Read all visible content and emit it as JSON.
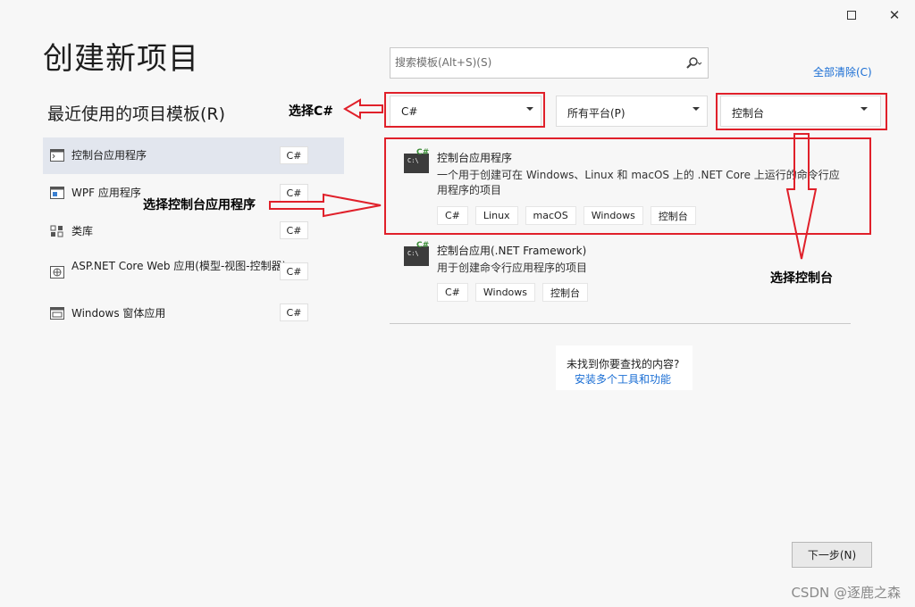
{
  "window": {
    "maximize_icon": "maximize-icon",
    "close_glyph": "✕"
  },
  "page_title": "创建新项目",
  "recent": {
    "heading": "最近使用的项目模板(R)",
    "items": [
      {
        "label": "控制台应用程序",
        "lang": "C#",
        "icon": "console-app-icon"
      },
      {
        "label": "WPF 应用程序",
        "lang": "C#",
        "icon": "wpf-app-icon"
      },
      {
        "label": "类库",
        "lang": "C#",
        "icon": "class-library-icon"
      },
      {
        "label": "ASP.NET Core Web 应用(模型-视图-控制器)",
        "lang": "C#",
        "icon": "web-app-icon"
      },
      {
        "label": "Windows 窗体应用",
        "lang": "C#",
        "icon": "winforms-app-icon"
      }
    ]
  },
  "search": {
    "placeholder": "搜索模板(Alt+S)(S)",
    "icon": "search-icon"
  },
  "clear_all": "全部清除(C)",
  "filters": {
    "language": "C#",
    "platform": "所有平台(P)",
    "project_type": "控制台"
  },
  "templates": [
    {
      "name": "控制台应用程序",
      "badge": "C#",
      "icon_text": "C:\\",
      "description": "一个用于创建可在 Windows、Linux 和 macOS 上的 .NET Core 上运行的命令行应用程序的项目",
      "tags": [
        "C#",
        "Linux",
        "macOS",
        "Windows",
        "控制台"
      ]
    },
    {
      "name": "控制台应用(.NET Framework)",
      "badge": "C#",
      "icon_text": "C:\\",
      "description": "用于创建命令行应用程序的项目",
      "tags": [
        "C#",
        "Windows",
        "控制台"
      ]
    }
  ],
  "not_found": {
    "question": "未找到你要查找的内容?",
    "link": "安装多个工具和功能"
  },
  "next_button": "下一步(N)",
  "annotations": {
    "choose_csharp": "选择C#",
    "choose_console_app": "选择控制台应用程序",
    "choose_console": "选择控制台"
  },
  "watermark": "CSDN @逐鹿之森",
  "colors": {
    "annotation_red": "#e0202a",
    "link_blue": "#1a6ed4",
    "selected_bg": "#e2e6ee"
  }
}
